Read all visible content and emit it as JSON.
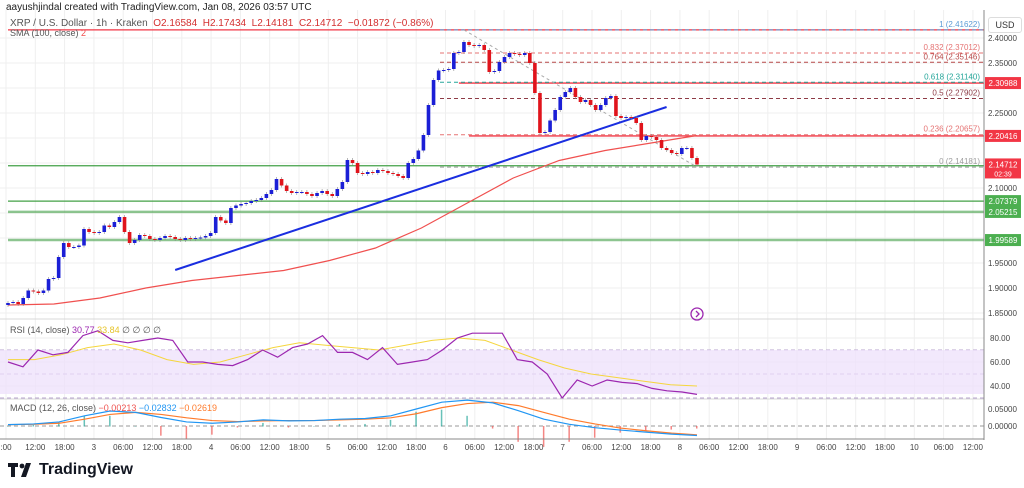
{
  "header": {
    "credit": "aayushjindal created with TradingView.com, Jan 08, 2026 03:57 UTC",
    "symbol": "XRP / U.S. Dollar · 1h · Kraken",
    "open": "O2.16584",
    "high": "H2.17434",
    "low": "L2.14181",
    "close": "C2.14712",
    "change": "−0.01872 (−0.86%)",
    "sma_label": "SMA (100, close)",
    "sma_value": "2"
  },
  "currency": "USD",
  "footer": {
    "logo": "TradingView"
  },
  "colors": {
    "up": "#1b1fd6",
    "down": "#e0141c",
    "sma": "#f0504f",
    "trend": "#1a2ee0",
    "support": "#43a047",
    "resistance": "#f23645",
    "rsi": "#9c27b0",
    "rsi_signal": "#f5d63d",
    "macd": "#2196f3",
    "signal": "#ff7b2c"
  },
  "chart_data": {
    "type": "candlestick",
    "title": "XRP / U.S. Dollar · 1h · Kraken",
    "interval": "1h",
    "ylim": [
      1.835,
      2.43
    ],
    "y_ticks": [
      "2.40000",
      "2.35000",
      "2.25000",
      "2.10000",
      "1.95000",
      "1.90000",
      "1.85000"
    ],
    "y_tick_values": [
      2.4,
      2.35,
      2.25,
      2.1,
      1.95,
      1.9,
      1.85
    ],
    "x_ticks": [
      ":00",
      "12:00",
      "18:00",
      "3",
      "06:00",
      "12:00",
      "18:00",
      "4",
      "06:00",
      "12:00",
      "18:00",
      "5",
      "06:00",
      "12:00",
      "18:00",
      "6",
      "06:00",
      "12:00",
      "18:00",
      "7",
      "06:00",
      "12:00",
      "18:00",
      "8",
      "06:00",
      "12:00",
      "18:00",
      "9",
      "06:00",
      "12:00",
      "18:00",
      "10",
      "06:00",
      "12:00"
    ],
    "closes": [
      1.87,
      1.872,
      1.868,
      1.88,
      1.895,
      1.893,
      1.89,
      1.895,
      1.918,
      1.92,
      1.962,
      1.99,
      1.982,
      1.982,
      1.985,
      2.018,
      2.012,
      2.01,
      2.012,
      2.025,
      2.022,
      2.032,
      2.042,
      2.012,
      1.99,
      1.996,
      2.006,
      2.004,
      1.998,
      1.996,
      2.0,
      2.004,
      2.002,
      1.998,
      1.996,
      2.0,
      1.998,
      2.0,
      2.001,
      2.004,
      2.01,
      2.042,
      2.035,
      2.03,
      2.06,
      2.065,
      2.068,
      2.07,
      2.074,
      2.076,
      2.08,
      2.088,
      2.096,
      2.118,
      2.105,
      2.094,
      2.09,
      2.092,
      2.092,
      2.088,
      2.084,
      2.09,
      2.094,
      2.088,
      2.084,
      2.098,
      2.112,
      2.156,
      2.15,
      2.13,
      2.128,
      2.132,
      2.13,
      2.136,
      2.134,
      2.13,
      2.128,
      2.124,
      2.12,
      2.15,
      2.158,
      2.175,
      2.206,
      2.266,
      2.316,
      2.335,
      2.336,
      2.338,
      2.37,
      2.372,
      2.392,
      2.386,
      2.384,
      2.386,
      2.376,
      2.332,
      2.334,
      2.352,
      2.362,
      2.37,
      2.368,
      2.366,
      2.37,
      2.35,
      2.29,
      2.21,
      2.212,
      2.235,
      2.256,
      2.282,
      2.292,
      2.3,
      2.282,
      2.272,
      2.276,
      2.266,
      2.256,
      2.266,
      2.28,
      2.284,
      2.244,
      2.24,
      2.242,
      2.24,
      2.23,
      2.196,
      2.204,
      2.202,
      2.196,
      2.18,
      2.176,
      2.17,
      2.168,
      2.18,
      2.18,
      2.16,
      2.147
    ],
    "last_price": "2.14712",
    "countdown": "02:39",
    "sma100": [
      1.866,
      1.868,
      1.88,
      1.9,
      1.915,
      1.925,
      1.935,
      1.955,
      1.98,
      2.02,
      2.07,
      2.12,
      2.155,
      2.175,
      2.19,
      2.205
    ],
    "trendline": {
      "from_bar": 33,
      "from_price": 1.936,
      "to_bar": 130,
      "to_price": 2.262
    },
    "horizontal_levels": [
      {
        "price": 2.41622,
        "kind": "resistance",
        "badge": null,
        "from_bar": 0
      },
      {
        "price": 2.30988,
        "kind": "resistance",
        "badge": "2.30988",
        "from_bar": 89
      },
      {
        "price": 2.20416,
        "kind": "resistance",
        "badge": "2.20416",
        "from_bar": 91
      },
      {
        "price": 2.14455,
        "kind": "support",
        "badge": "2.14455",
        "from_bar": 0
      },
      {
        "price": 2.07379,
        "kind": "support",
        "badge": "2.07379",
        "from_bar": 0
      },
      {
        "price": 2.05215,
        "kind": "support-strong",
        "badge": "2.05215",
        "from_bar": 0
      },
      {
        "price": 1.99589,
        "kind": "support-strong",
        "badge": "1.99589",
        "from_bar": 0
      }
    ],
    "fibonacci": [
      {
        "label": "1 (2.41622)",
        "price": 2.41622,
        "color": "#5b9bd5"
      },
      {
        "label": "0.832 (2.37012)",
        "price": 2.37012,
        "color": "#e57373"
      },
      {
        "label": "0.764 (2.35146)",
        "price": 2.35146,
        "color": "#b84a4a"
      },
      {
        "label": "0.618 (2.31140)",
        "price": 2.3114,
        "color": "#26a69a"
      },
      {
        "label": "0.5 (2.27902)",
        "price": 2.27902,
        "color": "#8e3b46"
      },
      {
        "label": "0.236 (2.20657)",
        "price": 2.20657,
        "color": "#e57373"
      },
      {
        "label": "0 (2.14181)",
        "price": 2.14181,
        "color": "#9e9e9e"
      }
    ],
    "rsi": {
      "label": "RSI (14, close)",
      "value": "30.77",
      "signal_value": "33.84",
      "extra": "∅ ∅ ∅ ∅",
      "ticks": [
        "80.00",
        "60.00",
        "40.00"
      ],
      "tick_values": [
        80,
        60,
        40
      ],
      "band": [
        30,
        70
      ],
      "values": [
        60,
        56,
        70,
        66,
        68,
        82,
        86,
        78,
        76,
        78,
        80,
        78,
        60,
        60,
        58,
        57,
        62,
        70,
        64,
        72,
        75,
        82,
        68,
        68,
        62,
        72,
        58,
        60,
        62,
        70,
        80,
        84,
        84,
        84,
        62,
        60,
        50,
        30,
        45,
        40,
        45,
        43,
        42,
        38,
        36,
        35,
        33
      ],
      "signal": [
        62,
        62,
        66,
        72,
        75,
        70,
        62,
        58,
        60,
        66,
        72,
        76,
        74,
        72,
        70,
        74,
        78,
        80,
        78,
        70,
        62,
        55,
        50,
        47,
        44,
        41,
        40
      ]
    },
    "macd": {
      "label": "MACD (12, 26, close)",
      "hist_value": "−0.00213",
      "macd_value": "−0.02832",
      "signal_value": "−0.02619",
      "ticks": [
        "0.05000",
        "0.00000"
      ],
      "tick_values": [
        0.05,
        0.0
      ],
      "macd_line": [
        0.004,
        0.006,
        0.012,
        0.03,
        0.044,
        0.04,
        0.025,
        0.012,
        0.008,
        0.012,
        0.018,
        0.015,
        0.016,
        0.02,
        0.022,
        0.03,
        0.05,
        0.07,
        0.076,
        0.068,
        0.045,
        0.02,
        0.005,
        -0.005,
        -0.012,
        -0.018,
        -0.024,
        -0.028
      ],
      "signal_line": [
        0.004,
        0.005,
        0.008,
        0.02,
        0.034,
        0.04,
        0.034,
        0.024,
        0.016,
        0.013,
        0.015,
        0.016,
        0.016,
        0.018,
        0.02,
        0.024,
        0.036,
        0.054,
        0.066,
        0.07,
        0.06,
        0.04,
        0.02,
        0.006,
        -0.006,
        -0.014,
        -0.021,
        -0.026
      ]
    }
  }
}
